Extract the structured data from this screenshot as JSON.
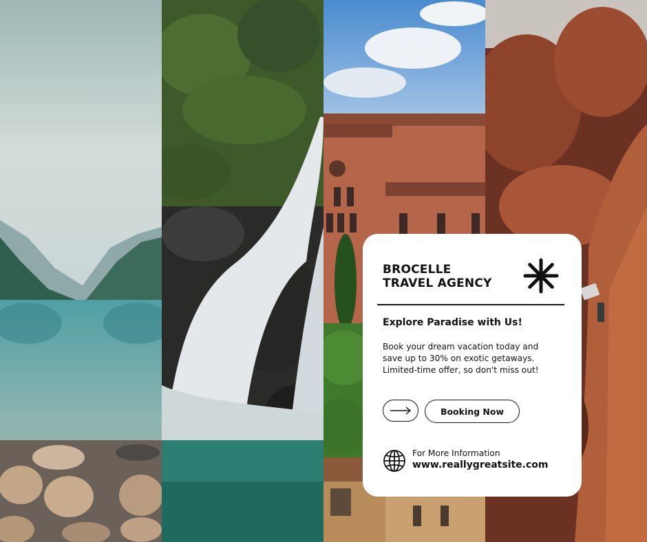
{
  "card": {
    "brand_line1": "BROCELLE",
    "brand_line2": "TRAVEL AGENCY",
    "headline": "Explore Paradise with Us!",
    "description_lines": [
      "Book your dream vacation today and",
      "save up to 30% on exotic getaways.",
      "Limited-time offer, so don't miss out!"
    ],
    "booking_button": "Booking Now",
    "info_label": "For More Information",
    "info_url": "www.reallygreatsite.com"
  },
  "photos": [
    "mountain-lake-photo",
    "waterfall-photo",
    "brick-cathedral-photo",
    "red-rock-climber-photo"
  ],
  "icons": [
    "asterisk-icon",
    "arrow-right-icon",
    "globe-icon"
  ],
  "colors": {
    "card_bg": "#ffffff",
    "text": "#111111"
  }
}
